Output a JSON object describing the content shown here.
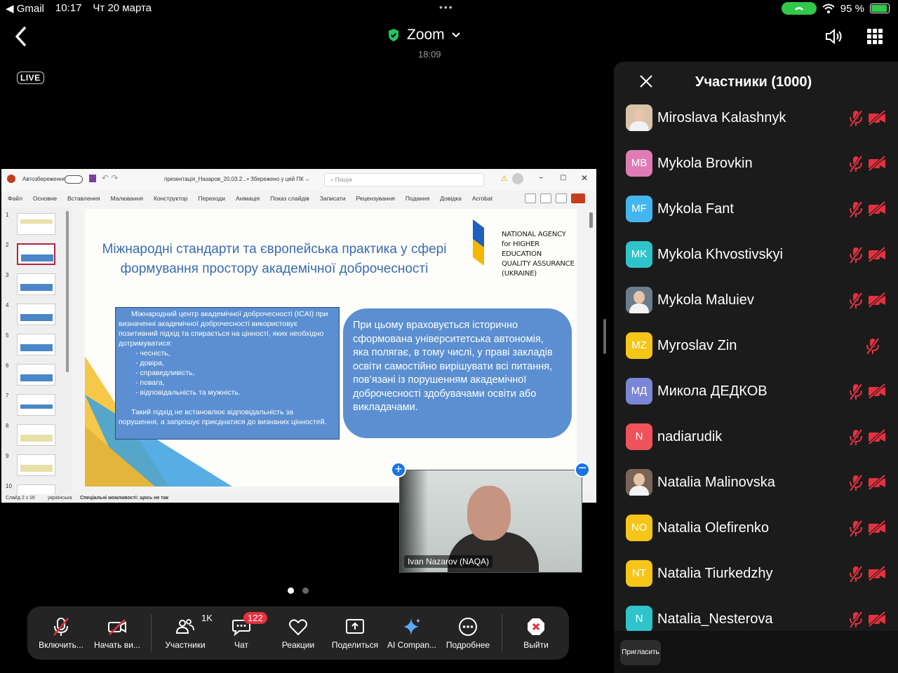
{
  "status_bar": {
    "back_app": "◀ Gmail",
    "time": "10:17",
    "date": "Чт 20 марта",
    "battery": "95 %"
  },
  "top_bar": {
    "app_title": "Zoom",
    "elapsed": "18:09",
    "live_badge": "LIVE"
  },
  "powerpoint": {
    "autosave": "Автозбереження",
    "filename": "презентація_Назаров_20.03.2...",
    "saved": "• Збережено у цей ПК ⌵",
    "search_placeholder": "Пошук",
    "menu": [
      "Файл",
      "Основне",
      "Вставлення",
      "Малювання",
      "Конструктор",
      "Переходи",
      "Анімація",
      "Показ слайдів",
      "Записати",
      "Рецензування",
      "Подання",
      "Довідка",
      "Acrobat"
    ],
    "thumb_numbers": [
      "1",
      "2",
      "3",
      "4",
      "5",
      "6",
      "7",
      "8",
      "9",
      "10"
    ],
    "status_slide": "Слайд 2 з 16",
    "status_lang": "українська",
    "status_access": "Спеціальні можливості: щось не так"
  },
  "slide": {
    "title": "Міжнародні стандарти та європейська практика у сфері формування простору академічної доброчесності",
    "logo_lines": [
      "NATIONAL AGENCY",
      "for HIGHER EDUCATION",
      "QUALITY ASSURANCE",
      "(UKRAINE)"
    ],
    "left_box": {
      "intro": "Міжнародний центр академічної доброчесності (ICAI) при визначенні академічної доброчесності використовує позитивний підхід та спирається на цінності, яких необхідно дотримуватися:",
      "values": [
        "- чесність,",
        "- довіра,",
        "- справедливість,",
        "- повага,",
        "- відповідальність та мужність."
      ],
      "closing": "Такий підхід не встановлює відповідальність за порушення, а запрошує приєднатися до визнаних цінностей."
    },
    "right_box": "При цьому враховується історично сформована університетська автономія, яка полягає, в тому числі, у праві закладів освіти самостійно вирішувати всі питання, пов’язані із порушенням академічної доброчесності здобувачами освіти або викладачами."
  },
  "video": {
    "name": "Ivan Nazarov (NAQA)"
  },
  "toolbar": {
    "mic": "Включить...",
    "video": "Начать ви...",
    "participants": "Участники",
    "participants_count": "1K",
    "chat": "Чат",
    "chat_badge": "122",
    "reactions": "Реакции",
    "share": "Поделиться",
    "ai": "AI Compan...",
    "more": "Подробнее",
    "leave": "Выйти"
  },
  "participants_panel": {
    "title": "Участники (1000)",
    "invite": "Пригласить",
    "items": [
      {
        "initials": "",
        "name": "Miroslava Kalashnyk",
        "color": "#d9c3a8",
        "photo": true,
        "cam": true
      },
      {
        "initials": "MB",
        "name": "Mykola Brovkin",
        "color": "#e07bb4",
        "photo": false,
        "cam": true
      },
      {
        "initials": "MF",
        "name": "Mykola Fant",
        "color": "#44b6ef",
        "photo": false,
        "cam": true
      },
      {
        "initials": "MK",
        "name": "Mykola Khvostivskyi",
        "color": "#2ec4c9",
        "photo": false,
        "cam": true
      },
      {
        "initials": "",
        "name": "Mykola Maluiev",
        "color": "#6b7c8a",
        "photo": true,
        "cam": true
      },
      {
        "initials": "MZ",
        "name": "Myroslav Zin",
        "color": "#f5c518",
        "photo": false,
        "cam": false
      },
      {
        "initials": "МД",
        "name": "Микола ДЕДКОВ",
        "color": "#7a86d6",
        "photo": false,
        "cam": true
      },
      {
        "initials": "N",
        "name": "nadiarudik",
        "color": "#f0525a",
        "photo": false,
        "cam": true
      },
      {
        "initials": "",
        "name": "Natalia Malinovska",
        "color": "#7a6456",
        "photo": true,
        "cam": true
      },
      {
        "initials": "NO",
        "name": "Natalia Olefirenko",
        "color": "#f5c518",
        "photo": false,
        "cam": true
      },
      {
        "initials": "NT",
        "name": "Natalia Tiurkedzhy",
        "color": "#f5c518",
        "photo": false,
        "cam": true
      },
      {
        "initials": "N",
        "name": "Natalia_Nesterova",
        "color": "#2ec4c9",
        "photo": false,
        "cam": true
      }
    ]
  },
  "colors": {
    "accent_blue": "#1a73e8",
    "muted_red": "#e7303f",
    "slide_blue": "#5b8fd1",
    "slide_title": "#3b6bb0"
  }
}
